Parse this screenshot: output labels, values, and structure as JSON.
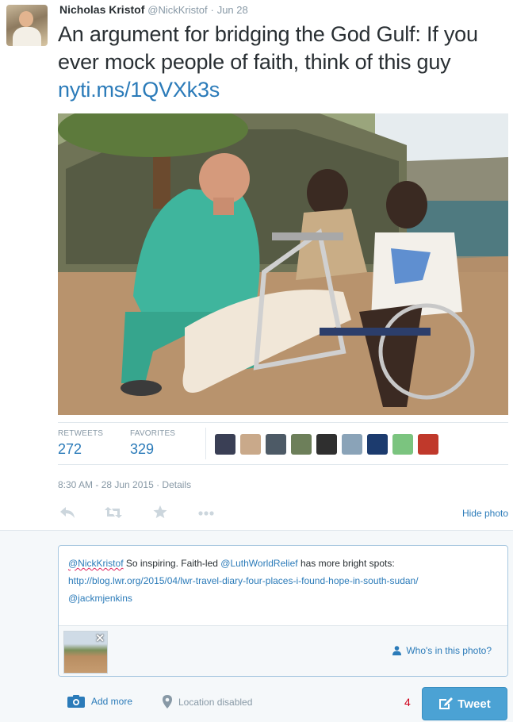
{
  "tweet": {
    "author_name": "Nicholas Kristof",
    "author_handle": "@NickKristof",
    "separator": "·",
    "date": "Jun 28",
    "text_prefix": "An argument for bridging the God Gulf: If you ever mock people of faith, think of this guy ",
    "link": "nyti.ms/1QVXk3s",
    "stats": {
      "retweets_label": "RETWEETS",
      "retweets_count": "272",
      "favorites_label": "FAVORITES",
      "favorites_count": "329"
    },
    "timestamp": "8:30 AM - 28 Jun 2015",
    "meta_separator": " · ",
    "details_label": "Details",
    "hide_photo_label": "Hide photo",
    "favoriter_avatar_colors": [
      "#3a3f55",
      "#c9a98a",
      "#4d5a66",
      "#6d7f5a",
      "#2f2f2f",
      "#8aa3b8",
      "#1c3b6e",
      "#7bc47f",
      "#c0392b"
    ]
  },
  "actions": {
    "reply_icon": "reply-icon",
    "retweet_icon": "retweet-icon",
    "favorite_icon": "star-icon",
    "more_icon": "more-icon"
  },
  "reply": {
    "mention_1": "@NickKristof",
    "text_1": " So inspiring. Faith-led ",
    "mention_2": "@LuthWorldRelief",
    "text_2": " has more bright spots:",
    "url": "http://blog.lwr.org/2015/04/lwr-travel-diary-four-places-i-found-hope-in-south-sudan/",
    "mention_3": "@jackmjenkins",
    "tag_people_label": "Who's in this photo?",
    "add_more_label": "Add more",
    "location_label": "Location disabled",
    "char_counter": "4",
    "tweet_button_label": "Tweet"
  },
  "colors": {
    "link": "#2b7bb9",
    "muted": "#8899a6",
    "tweet_button": "#4ba2d4",
    "counter_warning": "#d0021b"
  }
}
